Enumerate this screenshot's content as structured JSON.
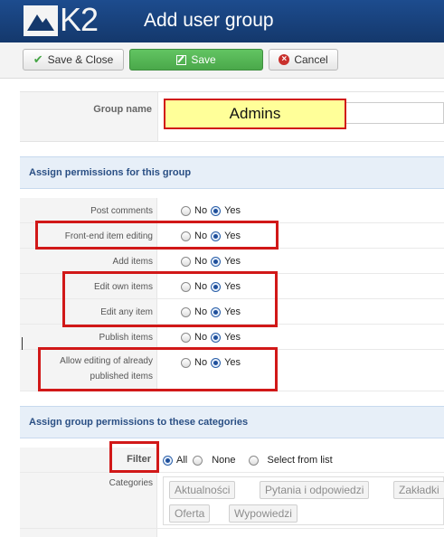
{
  "app": {
    "logo_text": "K2",
    "title": "Add user group"
  },
  "toolbar": {
    "save_close_label": "Save & Close",
    "save_label": "Save",
    "cancel_label": "Cancel"
  },
  "group": {
    "name_label": "Group name",
    "name_value": "Admins"
  },
  "permissions": {
    "section_title": "Assign permissions for this group",
    "no_label": "No",
    "yes_label": "Yes",
    "items": [
      {
        "label": "Post comments",
        "value": "Yes"
      },
      {
        "label": "Front-end item editing",
        "value": "Yes"
      },
      {
        "label": "Add items",
        "value": "Yes"
      },
      {
        "label": "Edit own items",
        "value": "Yes"
      },
      {
        "label": "Edit any item",
        "value": "Yes"
      },
      {
        "label": "Publish items",
        "value": "Yes"
      },
      {
        "label_line1": "Allow editing of already",
        "label_line2": "published items",
        "value": "Yes"
      }
    ]
  },
  "categories": {
    "section_title": "Assign group permissions to these categories",
    "filter_label": "Filter",
    "filter_options": [
      "All",
      "None",
      "Select from list"
    ],
    "filter_selected": "All",
    "categories_label": "Categories",
    "chips": [
      "Aktualności",
      "Pytania i odpowiedzi",
      "Zakładki",
      "Oferta",
      "Wypowiedzi"
    ]
  },
  "colors": {
    "header_bg": "#1a4480",
    "highlight_red": "#d11818",
    "name_field_bg": "#ffff99",
    "save_green": "#5bb75b",
    "section_blue": "#2a4f84"
  }
}
